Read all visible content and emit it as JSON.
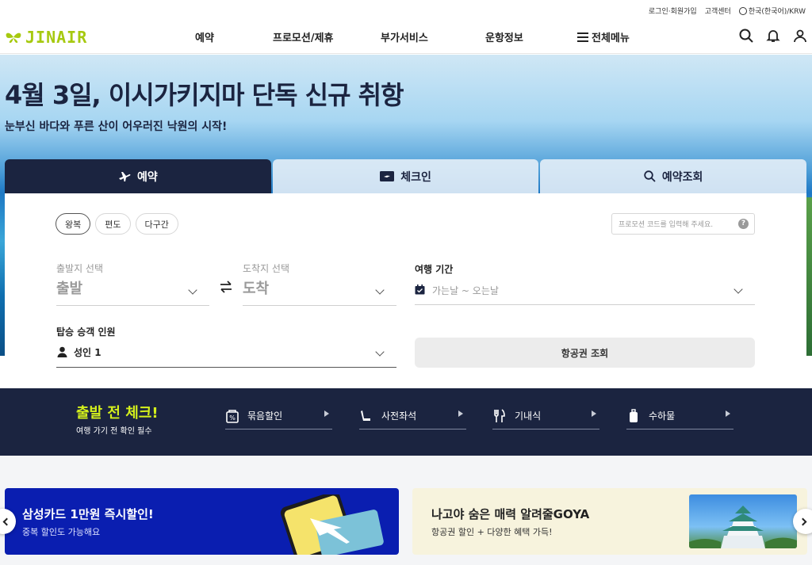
{
  "utility": {
    "login": "로그인·회원가입",
    "support": "고객센터",
    "language": "한국(한국어)/KRW"
  },
  "brand": {
    "logo_text": "JINAIR",
    "accent": "#a6c90f",
    "navy": "#1b2440"
  },
  "nav": {
    "items": [
      "예약",
      "프로모션/제휴",
      "부가서비스",
      "운항정보",
      "전체메뉴"
    ],
    "icons": [
      "search-icon",
      "bell-icon",
      "user-icon"
    ]
  },
  "hero": {
    "title": "4월 3일, 이시가키지마 단독 신규 취항",
    "subtitle": "눈부신 바다와 푸른 산이 어우러진 낙원의 시작!"
  },
  "booking": {
    "tabs": [
      {
        "label": "예약",
        "icon": "plane-icon",
        "active": true
      },
      {
        "label": "체크인",
        "icon": "ticket-icon",
        "active": false
      },
      {
        "label": "예약조회",
        "icon": "search-icon",
        "active": false
      }
    ],
    "trip_types": [
      "왕복",
      "편도",
      "다구간"
    ],
    "selected_trip": "왕복",
    "promo_placeholder": "프로모션 코드를 입력해 주세요.",
    "promo_help": "?",
    "departure": {
      "label": "출발지 선택",
      "value": "출발"
    },
    "arrival": {
      "label": "도착지 선택",
      "value": "도착"
    },
    "period": {
      "label": "여행 기간",
      "value": "가는날 ~ 오는날"
    },
    "passengers": {
      "label": "탑승 승객 인원",
      "value": "성인 1"
    },
    "search_button": "항공권 조회"
  },
  "precheck": {
    "title": "출발 전 체크!",
    "subtitle": "여행 가기 전 확인 필수",
    "items": [
      {
        "label": "묶음할인",
        "icon": "discount-icon"
      },
      {
        "label": "사전좌석",
        "icon": "seat-icon"
      },
      {
        "label": "기내식",
        "icon": "meal-icon"
      },
      {
        "label": "수하물",
        "icon": "baggage-icon"
      }
    ]
  },
  "banners": [
    {
      "title": "삼성카드 1만원 즉시할인!",
      "subtitle": "중복 할인도 가능해요"
    },
    {
      "title": "나고야 숨은 매력 알려줄GOYA",
      "subtitle": "항공권 할인 + 다양한 혜택 가득!"
    }
  ]
}
